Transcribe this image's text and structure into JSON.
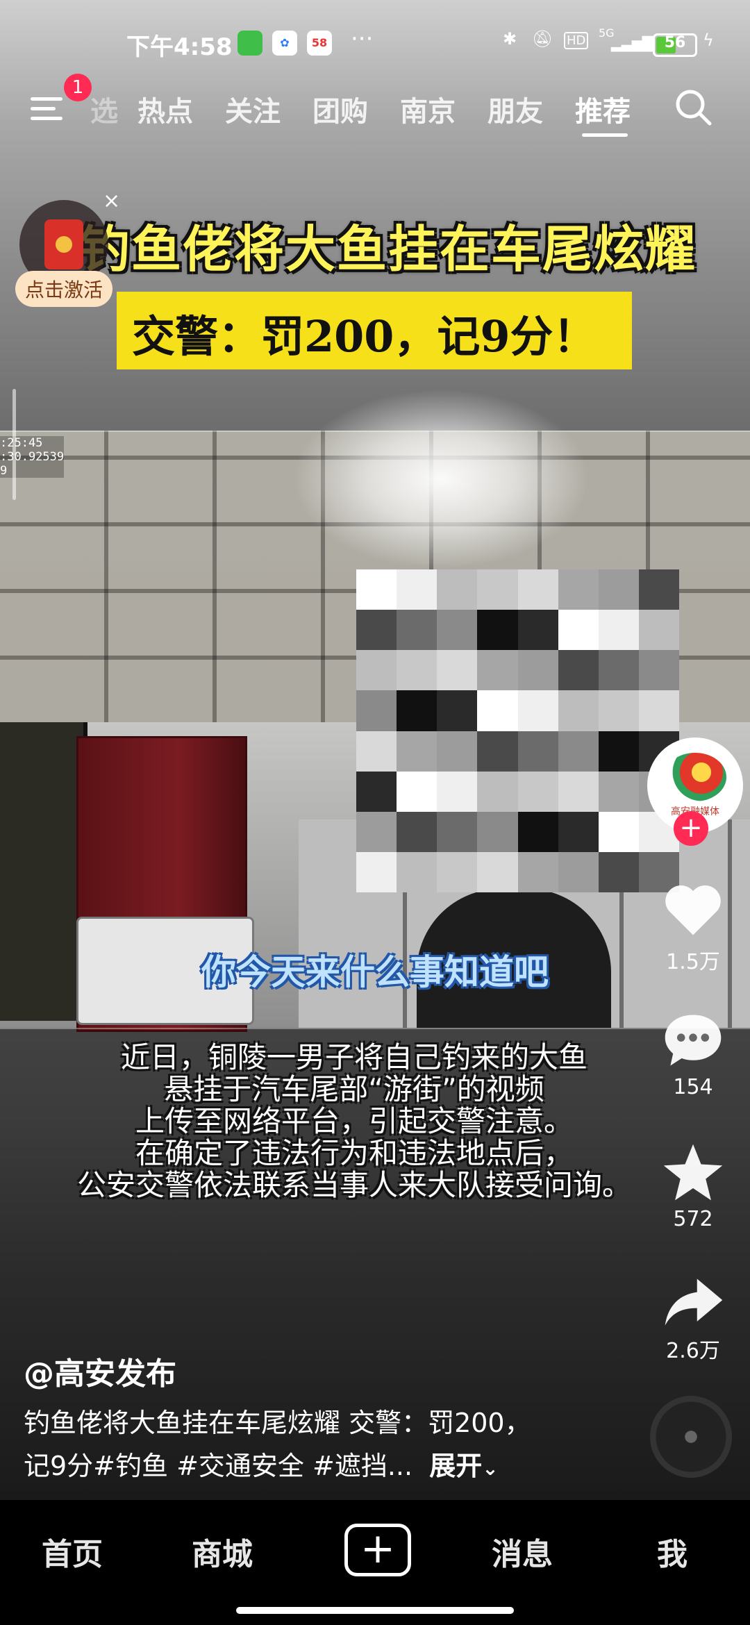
{
  "status_bar": {
    "time": "下午4:58",
    "app_58": "58",
    "more_dots": "···",
    "hd": "HD",
    "network": "5G",
    "battery": "56",
    "battery_level_percent": 56
  },
  "top_nav": {
    "notification_badge": "1",
    "tabs": [
      {
        "label": "选"
      },
      {
        "label": "热点"
      },
      {
        "label": "关注"
      },
      {
        "label": "团购"
      },
      {
        "label": "南京"
      },
      {
        "label": "朋友"
      },
      {
        "label": "推荐"
      }
    ],
    "active_tab": "推荐"
  },
  "red_packet": {
    "close": "×",
    "label": "点击激活"
  },
  "video": {
    "headline": "钓鱼佬将大鱼挂在车尾炫耀",
    "subheadline": "交警：罚200，记9分！",
    "timestamp_line1": ":25:45",
    "timestamp_line2": ":30.92539",
    "timestamp_line3": "9",
    "dialog_caption": "你今天来什么事知道吧",
    "paragraph_lines": [
      "近日，铜陵一男子将自己钓来的大鱼",
      "悬挂于汽车尾部“游街”的视频",
      "上传至网络平台，引起交警注意。",
      "在确定了违法行为和违法地点后，",
      "公安交警依法联系当事人来大队接受问询。"
    ]
  },
  "sidebar": {
    "avatar_text": "高安融媒体",
    "follow": "+",
    "likes": "1.5万",
    "comments": "154",
    "favorites": "572",
    "shares": "2.6万"
  },
  "post": {
    "author": "@高安发布",
    "description_line1": "钓鱼佬将大鱼挂在车尾炫耀 交警：罚200，",
    "description_line2": "记9分#钓鱼 #交通安全 #遮挡...",
    "expand": "展开"
  },
  "bottom_nav": {
    "home": "首页",
    "mall": "商城",
    "create": "+",
    "messages": "消息",
    "me": "我"
  },
  "colors": {
    "accent_red": "#ff2b54",
    "headline_yellow": "#fff35a",
    "subtitle_box": "#f6e01a",
    "caption_blue": "#bfe3ff"
  }
}
